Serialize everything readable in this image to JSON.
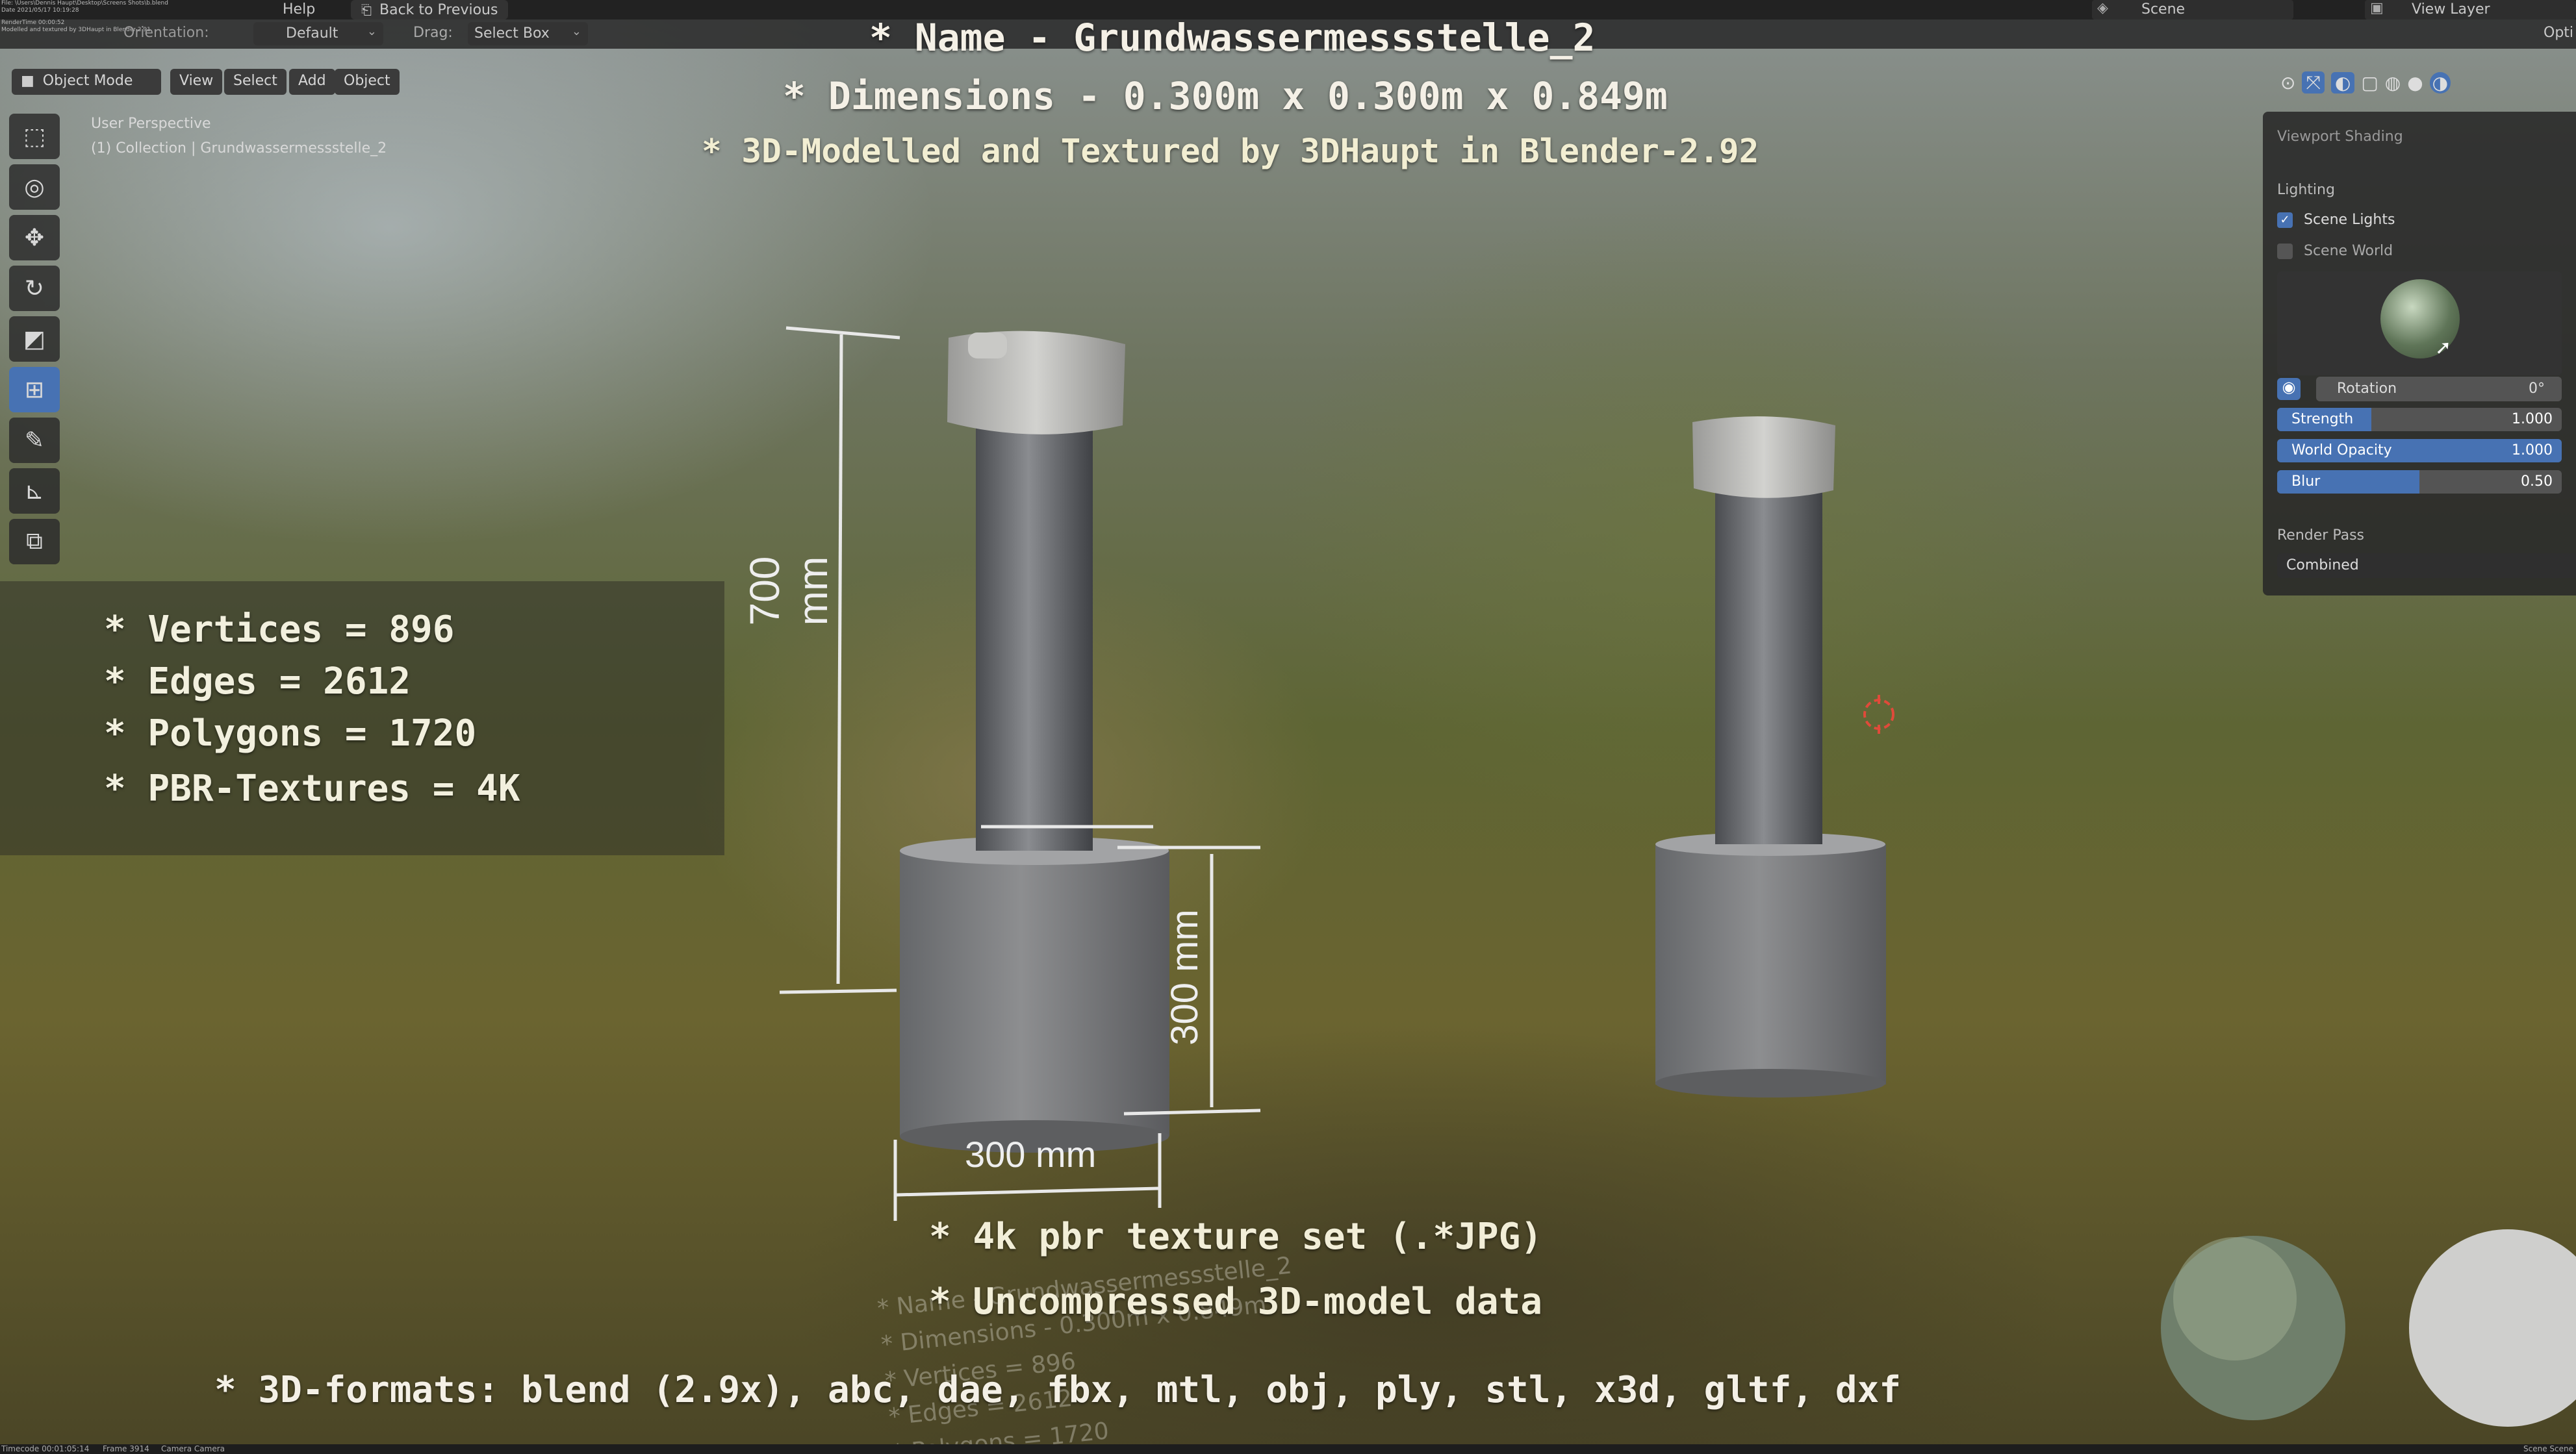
{
  "topbar": {
    "menu_help": "Help",
    "back_button": "Back to Previous",
    "scene_label": "Scene",
    "view_layer_label": "View Layer",
    "render_info": [
      "File: \\Users\\Dennis Haupt\\Desktop\\Screens Shots\\b.blend",
      "Date 2021/05/17 10:19:28",
      "RenderTime 00:00:52",
      "Modelled and textured by 3DHaupt in Blender-2.91"
    ],
    "orientation_label": "Orientation:",
    "orientation_value": "Default",
    "drag_label": "Drag:",
    "drag_value": "Select Box",
    "options_label": "Opti"
  },
  "header": {
    "mode": "Object Mode",
    "view": "View",
    "select": "Select",
    "add": "Add",
    "object": "Object",
    "perspective": "User Perspective",
    "collection": "(1) Collection | Grundwassermessstelle_2"
  },
  "title_overlay": {
    "name": "* Name - Grundwassermessstelle_2",
    "dimensions": "* Dimensions -  0.300m x 0.300m x 0.849m",
    "credit": "* 3D-Modelled and Textured by 3DHaupt in Blender-2.92"
  },
  "stats": {
    "vertices": "* Vertices = 896",
    "edges": "* Edges = 2612",
    "polygons": "* Polygons = 1720",
    "textures": "* PBR-Textures = 4K"
  },
  "dimension_labels": {
    "height": "700 mm",
    "base_height": "300 mm",
    "base_width": "300 mm"
  },
  "bottom_overlay": {
    "textures": "* 4k pbr texture set (.*JPG)",
    "uncompressed": "* Uncompressed 3D-model data",
    "formats": "* 3D-formats: blend (2.9x), abc, dae, fbx, mtl, obj, ply, stl, x3d, gltf, dxf"
  },
  "reflection": {
    "name": "* Name - Grundwassermessstelle_2",
    "dimensions": "* Dimensions -  0.300m x 0.849m",
    "vertices": "* Vertices = 896",
    "edges": "* Edges = 2612",
    "polygons": "* Polygons = 1720"
  },
  "shading_panel": {
    "title": "Viewport Shading",
    "lighting": "Lighting",
    "scene_lights": "Scene Lights",
    "scene_world": "Scene World",
    "rotation_label": "Rotation",
    "rotation_value": "0°",
    "strength_label": "Strength",
    "strength_value": "1.000",
    "strength_fill": 0.33,
    "world_opacity_label": "World Opacity",
    "world_opacity_value": "1.000",
    "world_opacity_fill": 1.0,
    "blur_label": "Blur",
    "blur_value": "0.50",
    "blur_fill": 0.5,
    "render_pass_label": "Render Pass",
    "render_pass_value": "Combined"
  },
  "statusbar": {
    "timecode": "Timecode 00:01:05:14",
    "frame": "Frame 3914",
    "camera": "Camera Camera",
    "right": "Scene Scene"
  },
  "colors": {
    "accent": "#4772b3",
    "panel": "#282828"
  }
}
